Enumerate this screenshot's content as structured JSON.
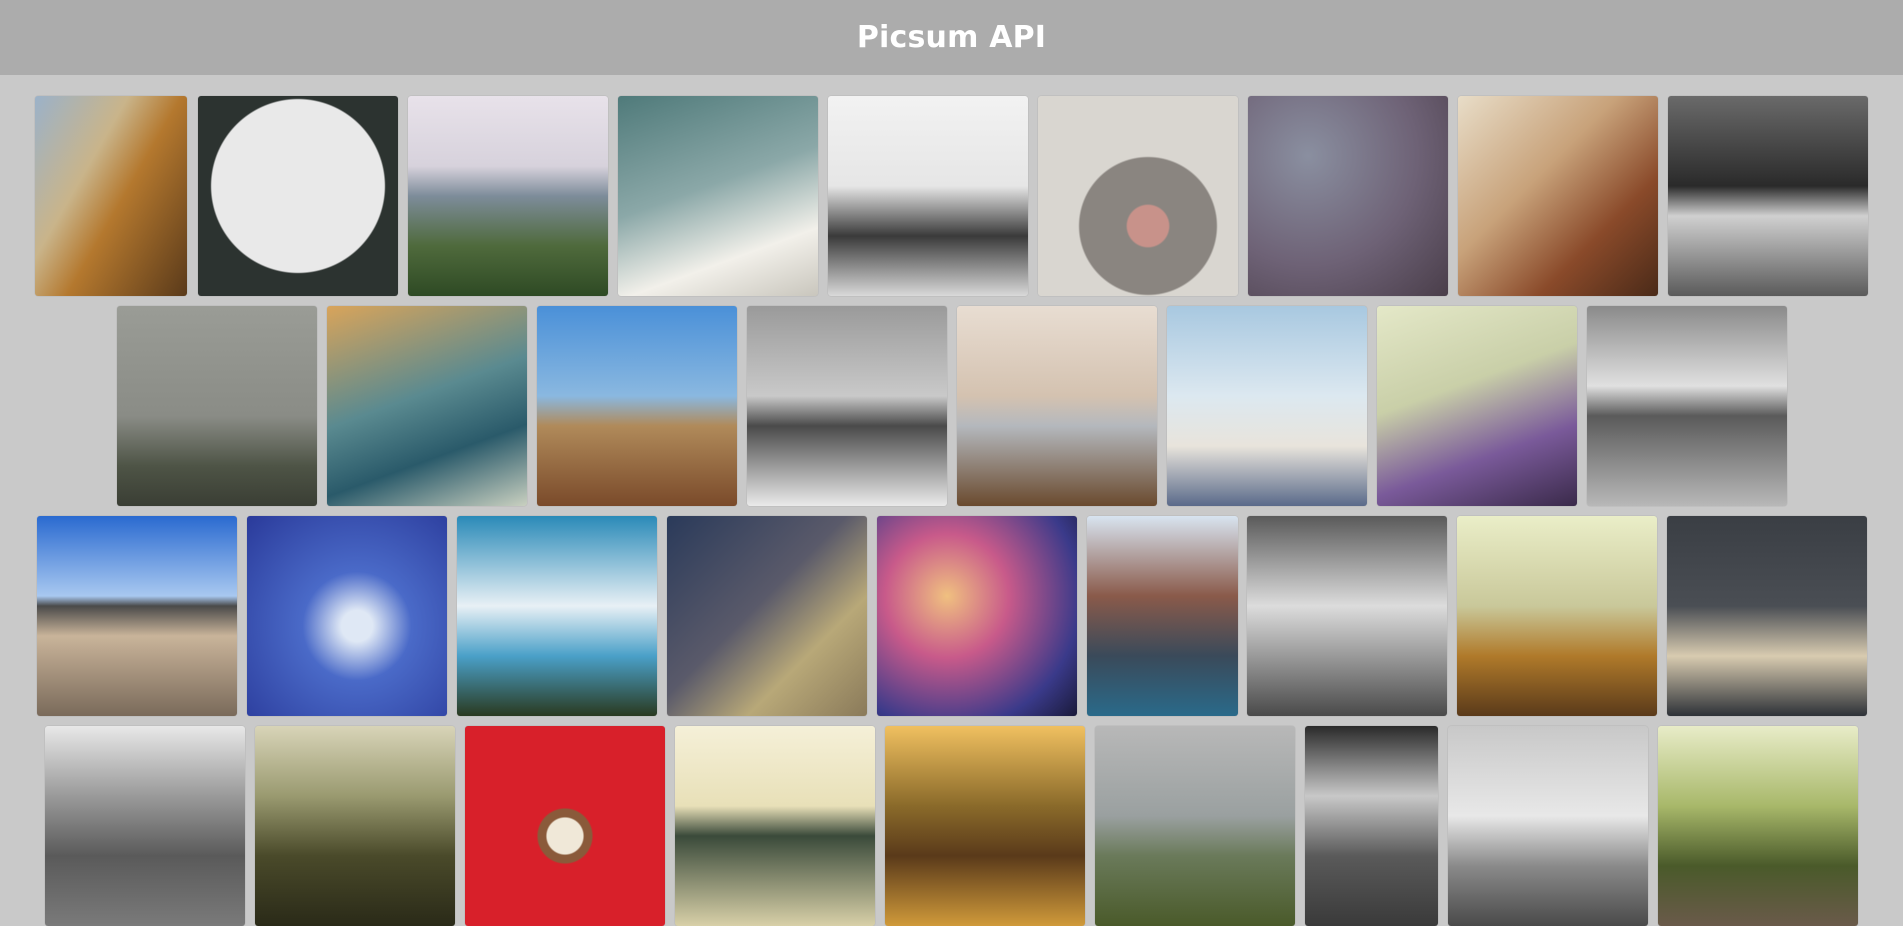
{
  "app": {
    "title": "Picsum API"
  },
  "rows": [
    [
      {
        "name": "cactus-photo",
        "bg": "linear-gradient(120deg,#9bb2c9 0%,#c9b48a 35%,#b4782e 55%,#5a3a1a 100%)"
      },
      {
        "name": "flatlay-gadgets-photo",
        "bg": "radial-gradient(circle at 50% 45%,#e9e9e9 0 58%,#2c3330 59% 100%)"
      },
      {
        "name": "coast-flowers-photo",
        "bg": "linear-gradient(180deg,#e8e2ea 0%,#d7d2dc 35%,#7d8c9a 50%,#4f6a3c 75%,#2e4a24 100%)"
      },
      {
        "name": "clouds-sky-photo",
        "bg": "linear-gradient(160deg,#4f7a7a 0%,#8ba8a8 45%,#f2f0ea 75%,#c9c6bd 100%)"
      },
      {
        "name": "turntable-photo",
        "bg": "linear-gradient(180deg,#f2f2f2 0%,#e6e6e6 45%,#3a3a3a 70%,#d9d9d9 100%)"
      },
      {
        "name": "cat-nose-photo",
        "bg": "radial-gradient(circle at 55% 65%,#c8928a 0 12%,#8a8580 13% 40%,#d9d6d0 41% 100%)"
      },
      {
        "name": "water-drops-photo",
        "bg": "radial-gradient(circle at 30% 30%,#8a8fa0 0%,#6e6276 55%,#4a3e4a 100%)"
      },
      {
        "name": "cafe-table-photo",
        "bg": "linear-gradient(135deg,#e8ddc8 0%,#c8a27a 40%,#8a4a2a 70%,#4a2a18 100%)"
      },
      {
        "name": "brooklyn-bridge-photo",
        "bg": "linear-gradient(180deg,#6a6a6a 0%,#2a2a2a 45%,#d0d0d0 60%,#5a5a5a 100%)"
      }
    ],
    [
      {
        "name": "foggy-coast-photo",
        "bg": "linear-gradient(180deg,#9a9c96 0%,#8a8c86 55%,#4e5446 80%,#3a3e34 100%)"
      },
      {
        "name": "tuk-tuk-photo",
        "bg": "linear-gradient(160deg,#d9a45a 0%,#5a8a90 45%,#2a5a6a 70%,#c9d0c0 100%)"
      },
      {
        "name": "desert-valley-photo",
        "bg": "linear-gradient(180deg,#4a90d8 0%,#8ab8e0 45%,#b08a5a 60%,#7a4a2a 100%)"
      },
      {
        "name": "pier-bw-photo",
        "bg": "linear-gradient(180deg,#9a9a9a 0%,#c9c9c9 45%,#4a4a4a 60%,#eaeaea 100%)"
      },
      {
        "name": "laptop-desk-photo",
        "bg": "linear-gradient(180deg,#e8ddd2 0%,#d4c2b0 45%,#b4b8bd 60%,#6a4a2e 100%)"
      },
      {
        "name": "santorini-photo",
        "bg": "linear-gradient(180deg,#a8c8e0 0%,#dce8f0 45%,#e8e4dc 70%,#5a6a8a 100%)"
      },
      {
        "name": "boat-bird-photo",
        "bg": "linear-gradient(160deg,#e4e8c8 0%,#c9cfa8 40%,#7a5a9a 70%,#3a2a4a 100%)"
      },
      {
        "name": "cloudy-beach-photo",
        "bg": "linear-gradient(180deg,#8a8a8a 0%,#e0e0e0 40%,#5a5a5a 55%,#b8b8b8 100%)"
      }
    ],
    [
      {
        "name": "sunset-pier-photo",
        "bg": "linear-gradient(180deg,#2a6ad0 0%,#a8c8f0 40%,#4a4a4a 45%,#c9b49a 60%,#7a6a5a 100%)"
      },
      {
        "name": "blue-sky-feather-photo",
        "bg": "radial-gradient(ellipse at 55% 55%,#dfe8f5 0 10%,#4a6ac8 35%,#2a3a9a 100%)"
      },
      {
        "name": "mountain-clouds-photo",
        "bg": "linear-gradient(180deg,#2a8ab8 0%,#e8f0f5 45%,#4aa0c8 70%,#2a3a20 100%)"
      },
      {
        "name": "tree-stump-sprout-photo",
        "bg": "linear-gradient(135deg,#2a3a5a 0%,#5a5a6a 45%,#b8a878 70%,#8a7a5a 100%)"
      },
      {
        "name": "bokeh-lights-photo",
        "bg": "radial-gradient(circle at 35% 40%,#f0c080 0%,#c85a8a 35%,#3a3a8a 75%,#1a1a3a 100%)"
      },
      {
        "name": "city-street-photo",
        "bg": "linear-gradient(180deg,#d8e4f0 0%,#8a5a4a 40%,#3a4a5a 70%,#2a6a8a 100%)"
      },
      {
        "name": "lighthouse-photo",
        "bg": "linear-gradient(180deg,#5a5a5a 0%,#dcdcdc 45%,#9a9a9a 70%,#4a4a4a 100%)"
      },
      {
        "name": "fence-field-photo",
        "bg": "linear-gradient(180deg,#eaeec8 0%,#c9c89a 45%,#b07a2a 70%,#5a3a1a 100%)"
      },
      {
        "name": "desk-setup-photo",
        "bg": "linear-gradient(180deg,#3a3e44 0%,#4a4e54 45%,#d8cbb0 70%,#2e3238 100%)"
      }
    ],
    [
      {
        "name": "town-bw-photo",
        "bg": "linear-gradient(180deg,#e8e8e8 0%,#9a9a9a 35%,#5a5a5a 65%,#7a7a7a 100%)"
      },
      {
        "name": "misty-forest-sun-photo",
        "bg": "linear-gradient(180deg,#d8d4b8 0%,#9a9a70 35%,#4a4a2a 65%,#2a2a18 100%)"
      },
      {
        "name": "coffee-cup-photo",
        "bg": "radial-gradient(circle at 50% 55%,#f0e8d8 0 12%,#8a5a3a 13% 18%,#d8202a 19% 100%)"
      },
      {
        "name": "girl-sunglasses-photo",
        "bg": "linear-gradient(180deg,#f5f0d8 0%,#e8e0b8 40%,#3a4a3a 55%,#d8d0a8 100%)"
      },
      {
        "name": "girl-sunset-field-photo",
        "bg": "linear-gradient(180deg,#f0c060 0%,#8a6a2a 40%,#5a3a1a 65%,#d09a3a 100%)"
      },
      {
        "name": "meadow-mountain-photo",
        "bg": "linear-gradient(180deg,#b8b8b8 0%,#9aa0a0 45%,#6a7a5a 65%,#4a5a2a 100%)"
      },
      {
        "name": "hills-bw-photo",
        "bg": "linear-gradient(180deg,#2a2a2a 0%,#c8c8c8 35%,#5a5a5a 65%,#3a3a3a 100%)"
      },
      {
        "name": "pier-lamp-photo",
        "bg": "linear-gradient(180deg,#c8c8c8 0%,#e8e8e8 45%,#8a8a8a 70%,#4a4a4a 100%)"
      },
      {
        "name": "railway-tracks-photo",
        "bg": "linear-gradient(180deg,#e8ecc8 0%,#a8b86a 40%,#4a5a2a 70%,#6a5a4a 100%)"
      }
    ]
  ]
}
